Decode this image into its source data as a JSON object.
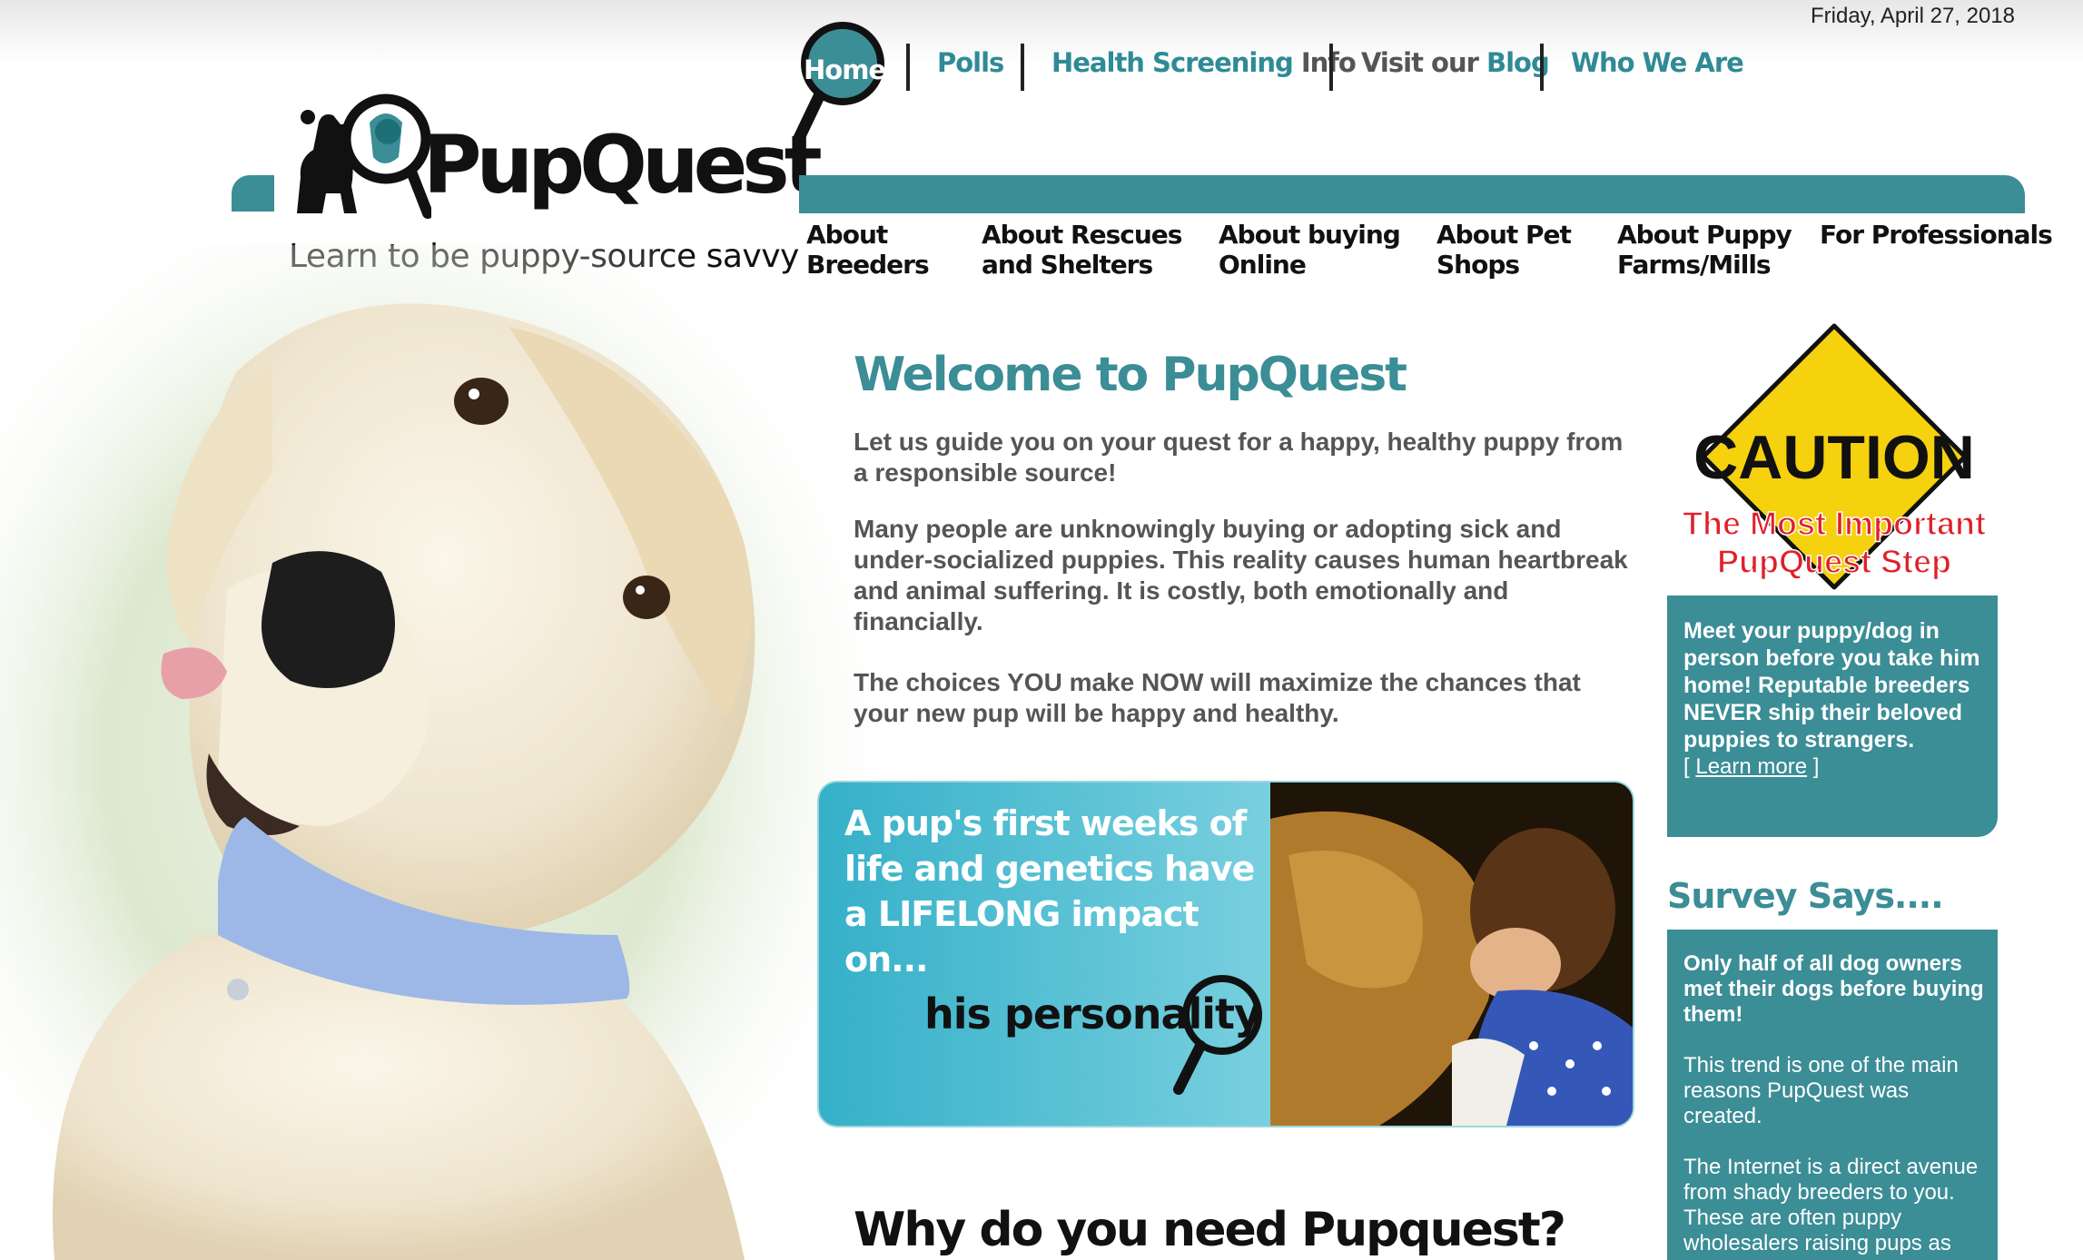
{
  "header": {
    "date": "Friday, April 27, 2018"
  },
  "topnav": {
    "home": "Home",
    "polls": "Polls",
    "health_screening": "Health Screening",
    "info": "Info",
    "visit_our": "Visit our",
    "blog": "Blog",
    "who_we_are": "Who We Are"
  },
  "logo": {
    "name": "PupQuest",
    "tagline": "Learn to be puppy-source savvy"
  },
  "mainnav": [
    {
      "line1": "About",
      "line2": "Breeders"
    },
    {
      "line1": "About Rescues",
      "line2": "and Shelters"
    },
    {
      "line1": "About buying",
      "line2": "Online"
    },
    {
      "line1": "About Pet",
      "line2": "Shops"
    },
    {
      "line1": "About Puppy",
      "line2": "Farms/Mills"
    },
    {
      "line1": "For Professionals",
      "line2": ""
    }
  ],
  "main": {
    "title": "Welcome to PupQuest",
    "p1": "Let us guide you on your quest for a happy, healthy puppy from a responsible source!",
    "p2": "Many people are unknowingly buying or adopting sick and under-socialized puppies. This reality causes human heartbreak and animal suffering. It is costly, both emotionally and financially.",
    "p3": "The choices YOU make NOW will maximize the chances that your new pup will be happy and healthy.",
    "banner_text": "A pup's first weeks of life and genetics have a LIFELONG impact on...",
    "banner_personality": "his personality",
    "why_title": "Why do you need Pupquest?"
  },
  "sidebar": {
    "caution": "CAUTION",
    "caution_line1": "The Most Important",
    "caution_line2": "PupQuest Step",
    "box1_text": "Meet your puppy/dog in person before you take him home! Reputable breeders NEVER ship their beloved puppies to strangers.",
    "learn_more": "Learn more",
    "survey_title": "Survey Says....",
    "survey_bold": "Only half of all dog owners met their dogs before buying them!",
    "survey_p2": "This trend is one of the main reasons PupQuest was created.",
    "survey_p3": "The Internet is a direct avenue from shady breeders to you. These are often puppy wholesalers raising pups as"
  },
  "colors": {
    "teal": "#3b8d96",
    "banner_blue": "#35b0c9",
    "caution_yellow": "#f5d10e",
    "caution_red": "#e0202a"
  }
}
